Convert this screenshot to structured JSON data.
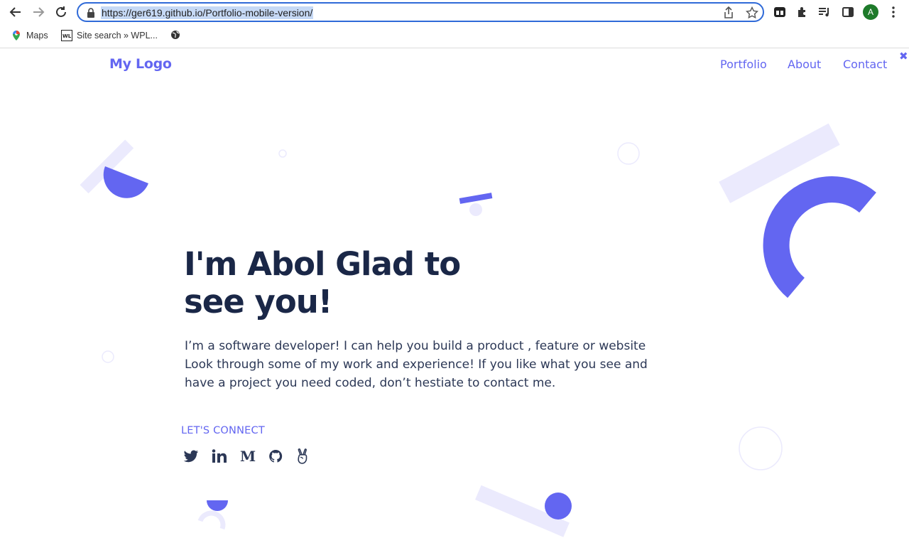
{
  "browser": {
    "url": "https://ger619.github.io/Portfolio-mobile-version/",
    "profile_initial": "A",
    "bookmarks": [
      {
        "label": "Maps",
        "icon": "maps-icon"
      },
      {
        "label": "Site search » WPL...",
        "icon": "wpl-icon"
      },
      {
        "label": "",
        "icon": "globe-icon"
      }
    ]
  },
  "header": {
    "logo": "My Logo",
    "nav": [
      "Portfolio",
      "About",
      "Contact"
    ],
    "close_symbol": "✖"
  },
  "hero": {
    "title_line1": "I'm Abol Glad to",
    "title_line2": "see you!",
    "description": "I’m a software developer! I can help you build a product , feature or website Look through some of my work and experience! If you like what you see and have a project you need coded, don’t hestiate to contact me.",
    "connect_label": "LET'S CONNECT",
    "socials": [
      "twitter-icon",
      "linkedin-icon",
      "medium-icon",
      "github-icon",
      "angellist-icon"
    ]
  },
  "colors": {
    "accent": "#6366f1",
    "accent_light": "#ebeafd",
    "heading": "#1a2747",
    "body": "#2c3856"
  }
}
